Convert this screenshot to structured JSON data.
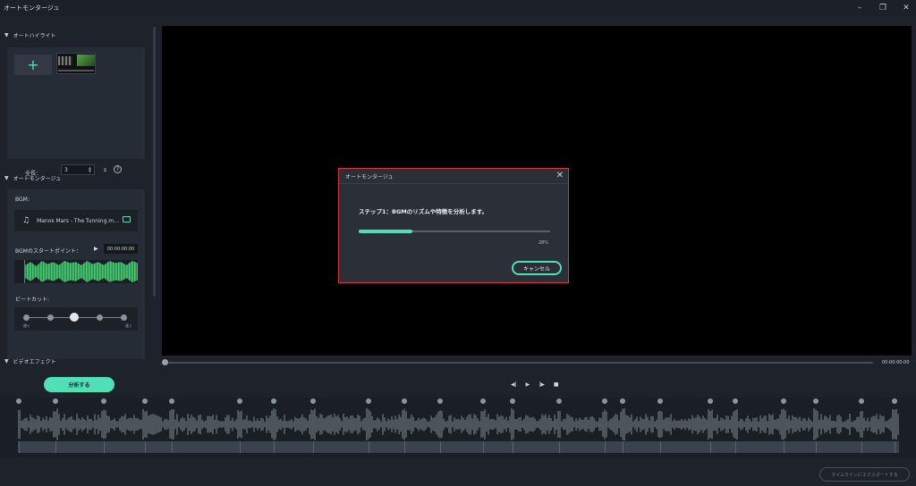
{
  "window": {
    "title": "オートモンタージュ",
    "minimize_icon": "–",
    "restore_icon": "❐",
    "close_icon": "✕"
  },
  "auto_highlight": {
    "header": "オートハイライト",
    "add_symbol": "+",
    "total_length_label": "全長：",
    "total_length_value": "3",
    "total_length_unit": "s",
    "help_symbol": "?"
  },
  "auto_montage": {
    "header": "オートモンタージュ",
    "bgm_label": "BGM:",
    "bgm_track": "Manos Mars - The Tunning.m...",
    "start_point_label": "BGMのスタートポイント：",
    "start_time": "00:00:00:00",
    "beat_cut_label": "ビートカット:",
    "beat_slow": "遅く",
    "beat_fast": "速く",
    "beat_level": 0.5
  },
  "video_effect": {
    "header": "ビデオエフェクト"
  },
  "analyze_button": "分析する",
  "preview": {
    "time": "00:00:00:00",
    "playhead_fraction": 0.0
  },
  "export_button": "タイムラインにエクスポートする",
  "dialog": {
    "title": "オートモンタージュ",
    "close_icon": "✕",
    "step_text": "ステップ1：BGMのリズムや特徴を分析します。",
    "progress": 28,
    "progress_text": "28%",
    "cancel_label": "キャンセル"
  },
  "colors": {
    "accent": "#4fe0b6",
    "dialog_border": "#d4373c",
    "waveform": "#3cae63"
  }
}
